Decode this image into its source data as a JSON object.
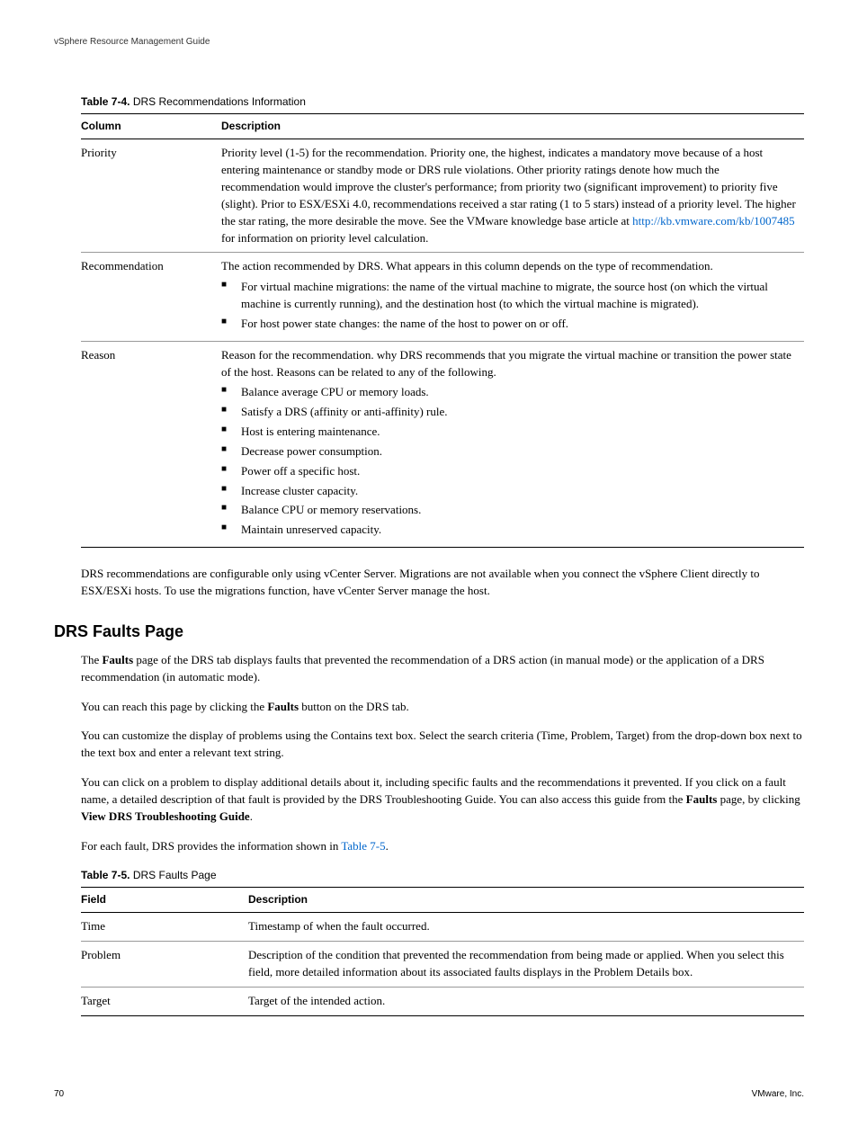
{
  "header": {
    "doc_title": "vSphere Resource Management Guide"
  },
  "table1": {
    "caption_num": "Table 7-4.",
    "caption_text": "DRS Recommendations Information",
    "h1": "Column",
    "h2": "Description",
    "rows": {
      "priority": {
        "label": "Priority",
        "desc_pre": "Priority level (1-5) for the recommendation. Priority one, the highest, indicates a mandatory move because of a host entering maintenance or standby mode or DRS rule violations. Other priority ratings denote how much the recommendation would improve the cluster's performance; from priority two (significant improvement) to priority five (slight). Prior to ESX/ESXi 4.0, recommendations received a star rating (1 to 5 stars) instead of a priority level. The higher the star rating, the more desirable the move. See the VMware knowledge base article at ",
        "desc_link": "http://kb.vmware.com/kb/1007485",
        "desc_post": " for information on priority level calculation."
      },
      "recommendation": {
        "label": "Recommendation",
        "desc": "The action recommended by DRS. What appears in this column depends on the type of recommendation.",
        "b1": "For virtual machine migrations: the name of the virtual machine to migrate, the source host (on which the virtual machine is currently running), and the destination host (to which the virtual machine is migrated).",
        "b2": "For host power state changes: the name of the host to power on or off."
      },
      "reason": {
        "label": "Reason",
        "desc": "Reason for the recommendation. why DRS recommends that you migrate the virtual machine or transition the power state of the host. Reasons can be related to any of the following.",
        "b1": "Balance average CPU or memory loads.",
        "b2": "Satisfy a DRS (affinity or anti-affinity) rule.",
        "b3": "Host is entering maintenance.",
        "b4": "Decrease power consumption.",
        "b5": "Power off a specific host.",
        "b6": "Increase cluster capacity.",
        "b7": "Balance CPU or memory reservations.",
        "b8": "Maintain unreserved capacity."
      }
    }
  },
  "para1": "DRS recommendations are configurable only using vCenter Server. Migrations are not available when you connect the vSphere Client directly to ESX/ESXi hosts. To use the migrations function, have vCenter Server manage the host.",
  "section": {
    "title": "DRS Faults Page",
    "p1_pre": "The ",
    "p1_bold": "Faults",
    "p1_post": " page of the DRS tab displays faults that prevented the recommendation of a DRS action (in manual mode) or the application of a DRS recommendation (in automatic mode).",
    "p2_pre": "You can reach this page by clicking the ",
    "p2_bold": "Faults",
    "p2_post": " button on the DRS tab.",
    "p3": "You can customize the display of problems using the Contains text box. Select the search criteria (Time, Problem, Target) from the drop-down box next to the text box and enter a relevant text string.",
    "p4_pre": "You can click on a problem to display additional details about it, including specific faults and the recommendations it prevented. If you click on a fault name, a detailed description of that fault is provided by the DRS Troubleshooting Guide. You can also access this guide from the ",
    "p4_b1": "Faults",
    "p4_mid": " page, by clicking ",
    "p4_b2": "View DRS Troubleshooting Guide",
    "p4_post": ".",
    "p5_pre": "For each fault, DRS provides the information shown in ",
    "p5_link": "Table 7-5",
    "p5_post": "."
  },
  "table2": {
    "caption_num": "Table 7-5.",
    "caption_text": "DRS Faults Page",
    "h1": "Field",
    "h2": "Description",
    "rows": {
      "time": {
        "label": "Time",
        "desc": "Timestamp of when the fault occurred."
      },
      "problem": {
        "label": "Problem",
        "desc": "Description of the condition that prevented the recommendation from being made or applied. When you select this field, more detailed information about its associated faults displays in the Problem Details box."
      },
      "target": {
        "label": "Target",
        "desc": "Target of the intended action."
      }
    }
  },
  "footer": {
    "page": "70",
    "company": "VMware, Inc."
  }
}
